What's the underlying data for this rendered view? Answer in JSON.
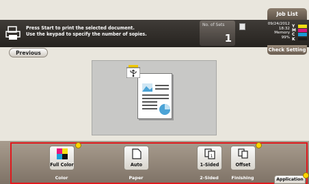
{
  "top": {
    "job_list_label": "Job List"
  },
  "header": {
    "message_line1": "Press Start to print the selected document.",
    "message_line2": "Use the keypad to specify the number of sopies.",
    "sets_label": "No. of Sets",
    "sets_value": "1",
    "date": "09/24/2012",
    "time": "18:32",
    "memory_label": "Memory",
    "memory_value": "99%",
    "toner_letters": [
      "Y",
      "M",
      "C",
      "K"
    ],
    "toner_colors": [
      "#f2dd13",
      "#d6157a",
      "#1a9ad8",
      "#1a1a1a"
    ]
  },
  "check_setting_label": "Check Setting",
  "previous_label": "Previous",
  "preview": {
    "accent_colors": {
      "usb": "#f0c800",
      "doc_blue": "#4ba3d6",
      "doc_lines": "#555555"
    }
  },
  "functions": [
    {
      "value": "Full Color",
      "caption": "Color",
      "has_indicator": true
    },
    {
      "value": "Auto",
      "caption": "Paper",
      "has_indicator": false
    },
    {
      "value": "1-Sided",
      "caption": "2-Sided",
      "has_indicator": false
    },
    {
      "value": "Offset",
      "caption": "Finishing",
      "has_indicator": true
    }
  ],
  "application_label": "Application",
  "highlight_color": "#e0191d"
}
